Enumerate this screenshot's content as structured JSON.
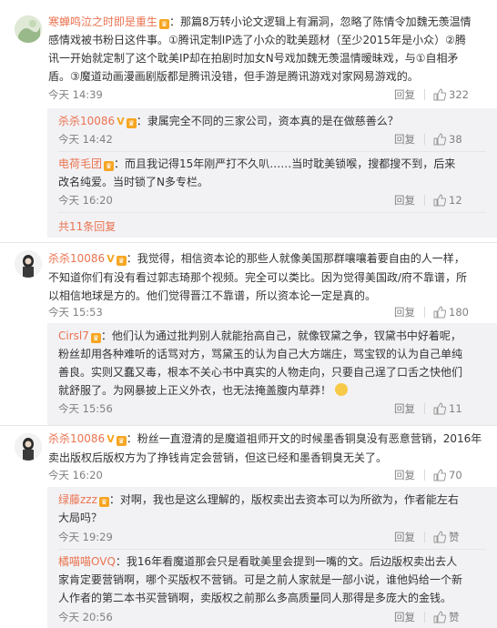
{
  "comments": [
    {
      "user": "寒蝉鸣泣之时即是重生",
      "lines": [
        "：那篇8万转小论文逻辑上有漏洞，忽略了陈情令加魏无羡温情",
        "感情戏被书粉日这件事。①腾讯定制IP选了小众的耽美题材（至少2015年是小众）②腾",
        "讯一开始就定制了这个耽美IP却在拍剧时加女N号戏加魏无羡温情暧昧戏，与①自相矛",
        "盾。③魔道动画漫画剧版都是腾讯没错，但手游是腾讯游戏对家网易游戏的。"
      ],
      "time": "今天 14:39",
      "reply": "回复",
      "likes": "322"
    },
    {
      "user": "杀杀10086",
      "text": "：隶属完全不同的三家公司，资本真的是在做慈善么？",
      "time": "今天 14:42",
      "reply": "回复",
      "likes": "38"
    },
    {
      "user": "电荷毛团",
      "lines": [
        "：而且我记得15年刚严打不久叭……当时耽美锁喉，搜都搜不到，后来",
        "改名纯爱。当时锁了N多专栏。"
      ],
      "time": "今天 16:20",
      "reply": "回复",
      "likes": "12"
    },
    {
      "more": "共11条回复"
    },
    {
      "user": "杀杀10086",
      "lines": [
        "：我觉得，相信资本论的那些人就像美国那群嚷嚷着要自由的人一样，",
        "不知道你们有没有看过郭志琦那个视频。完全可以类比。因为觉得美国政/府不靠谱，所",
        "以相信地球是方的。他们觉得晋江不靠谱，所以资本论一定是真的。"
      ],
      "time": "今天 15:53",
      "reply": "回复",
      "likes": "180"
    },
    {
      "user": "Cirsl7",
      "lines": [
        "：他们认为通过批判别人就能抬高自己，就像钗黛之争，钗黛书中好着呢，",
        "粉丝却用各种难听的话骂对方，骂黛玉的认为自己大方端庄，骂宝钗的认为自己单纯",
        "善良。实则又蠢又毒，根本不关心书中真实的人物走向，只要自己逞了口舌之快他们",
        "就舒服了。为网暴披上正义外衣，也无法掩盖腹内草莽！"
      ],
      "time": "今天 15:56",
      "reply": "回复",
      "likes": "11"
    },
    {
      "user": "杀杀10086",
      "lines": [
        "：粉丝一直澄清的是魔道祖师开文的时候墨香铜臭没有恶意营销，2016年",
        "卖出版权后版权方为了挣钱肯定会营销，但这已经和墨香铜臭无关了。"
      ],
      "time": "今天 16:20",
      "reply": "回复",
      "likes": "70"
    },
    {
      "user": "绿藤zzz",
      "lines": [
        "：对啊，我也是这么理解的，版权卖出去资本可以为所欲为，作者能左右",
        "大局吗？"
      ],
      "time": "今天 19:29",
      "reply": "回复",
      "likes": "赞"
    },
    {
      "user": "橘喵喵OVQ",
      "lines": [
        "：我16年看魔道那会只是看耽美里会提到一嘴的文。后边版权卖出去人",
        "家肯定要营销啊，哪个买版权不营销。可是之前人家就是一部小说，谁他妈给一个新",
        "人作者的第二本书买营销啊，卖版权之前那么多高质量同人那得是多庞大的金钱。"
      ],
      "time": "今天 20:56",
      "reply": "回复",
      "likes": "赞"
    }
  ],
  "icons": {
    "like": "thumbs-up-icon",
    "vip": "vip-badge-icon",
    "verified": "v-mark-icon",
    "emoji": "smile-emoji-icon"
  },
  "colors": {
    "username": "#eb7350",
    "meta": "#808080",
    "panel": "#f2f2f5"
  }
}
